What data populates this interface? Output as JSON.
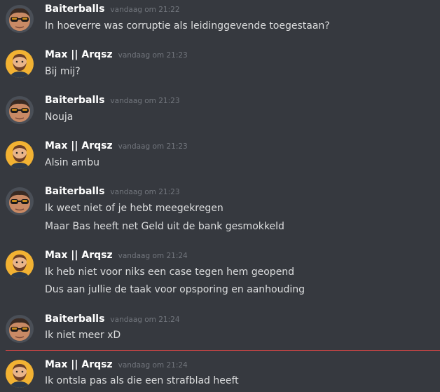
{
  "colors": {
    "background": "#36393f",
    "username": "#ffffff",
    "timestamp": "#72767d",
    "message_text": "#dcddde",
    "new_messages_divider": "#f04747"
  },
  "messages": [
    {
      "author": "Baiterballs",
      "time": "vandaag om 21:22",
      "avatar_icon": "sunglasses-man-avatar",
      "lines": [
        "In hoeverre was corruptie als leidinggevende toegestaan?"
      ]
    },
    {
      "author": "Max || Arqsz",
      "time": "vandaag om 21:23",
      "avatar_icon": "bearded-man-avatar",
      "lines": [
        "Bij mij?"
      ]
    },
    {
      "author": "Baiterballs",
      "time": "vandaag om 21:23",
      "avatar_icon": "sunglasses-man-avatar",
      "lines": [
        "Nouja"
      ]
    },
    {
      "author": "Max || Arqsz",
      "time": "vandaag om 21:23",
      "avatar_icon": "bearded-man-avatar",
      "lines": [
        "Alsin ambu"
      ]
    },
    {
      "author": "Baiterballs",
      "time": "vandaag om 21:23",
      "avatar_icon": "sunglasses-man-avatar",
      "lines": [
        "Ik weet niet of je hebt meegekregen",
        "Maar Bas heeft net Geld uit de bank gesmokkeld"
      ]
    },
    {
      "author": "Max || Arqsz",
      "time": "vandaag om 21:24",
      "avatar_icon": "bearded-man-avatar",
      "lines": [
        "Ik heb niet voor niks een case tegen hem geopend",
        "Dus aan jullie de taak voor opsporing en aanhouding"
      ]
    },
    {
      "author": "Baiterballs",
      "time": "vandaag om 21:24",
      "avatar_icon": "sunglasses-man-avatar",
      "lines": [
        "Ik niet meer xD"
      ]
    },
    {
      "author": "Max || Arqsz",
      "time": "vandaag om 21:24",
      "avatar_icon": "bearded-man-avatar",
      "lines": [
        "Ik ontsla pas als die een strafblad heeft"
      ]
    }
  ]
}
